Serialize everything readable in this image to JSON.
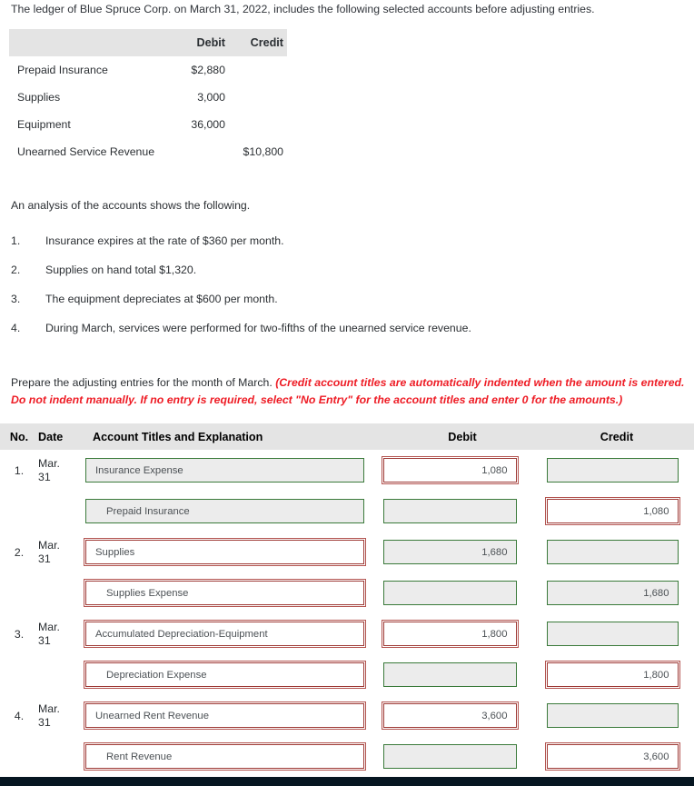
{
  "intro": "The ledger of Blue Spruce Corp. on March 31, 2022, includes the following selected accounts before adjusting entries.",
  "ledger": {
    "columns": {
      "debit": "Debit",
      "credit": "Credit"
    },
    "rows": [
      {
        "name": "Prepaid Insurance",
        "debit": "$2,880",
        "credit": ""
      },
      {
        "name": "Supplies",
        "debit": "3,000",
        "credit": ""
      },
      {
        "name": "Equipment",
        "debit": "36,000",
        "credit": ""
      },
      {
        "name": "Unearned Service Revenue",
        "debit": "",
        "credit": "$10,800"
      }
    ]
  },
  "analysis": {
    "lead": "An analysis of the accounts shows the following.",
    "items": [
      {
        "num": "1.",
        "text": "Insurance expires at the rate of $360 per month."
      },
      {
        "num": "2.",
        "text": "Supplies on hand total $1,320."
      },
      {
        "num": "3.",
        "text": "The equipment depreciates at $600 per month."
      },
      {
        "num": "4.",
        "text": "During March, services were performed for two-fifths of the unearned service revenue."
      }
    ]
  },
  "prompt": {
    "lead": "Prepare the adjusting entries for the month of March. ",
    "red": "(Credit account titles are automatically indented when the amount is entered. Do not indent manually. If no entry is required, select \"No Entry\" for the account titles and enter 0 for the amounts.)"
  },
  "journal": {
    "columns": {
      "no": "No.",
      "date": "Date",
      "account": "Account Titles and Explanation",
      "debit": "Debit",
      "credit": "Credit"
    },
    "rows": [
      {
        "no": "1.",
        "date_month": "Mar.",
        "date_day": "31",
        "account": "Insurance Expense",
        "account_state": "ok",
        "indent": false,
        "debit": "1,080",
        "debit_state": "bad",
        "credit": "",
        "credit_state": "ok"
      },
      {
        "no": "",
        "date_month": "",
        "date_day": "",
        "account": "Prepaid Insurance",
        "account_state": "ok",
        "indent": true,
        "debit": "",
        "debit_state": "ok",
        "credit": "1,080",
        "credit_state": "bad"
      },
      {
        "no": "2.",
        "date_month": "Mar.",
        "date_day": "31",
        "account": "Supplies",
        "account_state": "bad",
        "indent": false,
        "debit": "1,680",
        "debit_state": "ok",
        "credit": "",
        "credit_state": "ok"
      },
      {
        "no": "",
        "date_month": "",
        "date_day": "",
        "account": "Supplies Expense",
        "account_state": "bad",
        "indent": true,
        "debit": "",
        "debit_state": "ok",
        "credit": "1,680",
        "credit_state": "ok"
      },
      {
        "no": "3.",
        "date_month": "Mar.",
        "date_day": "31",
        "account": "Accumulated Depreciation-Equipment",
        "account_state": "bad",
        "indent": false,
        "debit": "1,800",
        "debit_state": "bad",
        "credit": "",
        "credit_state": "ok"
      },
      {
        "no": "",
        "date_month": "",
        "date_day": "",
        "account": "Depreciation Expense",
        "account_state": "bad",
        "indent": true,
        "debit": "",
        "debit_state": "ok",
        "credit": "1,800",
        "credit_state": "bad"
      },
      {
        "no": "4.",
        "date_month": "Mar.",
        "date_day": "31",
        "account": "Unearned Rent Revenue",
        "account_state": "bad",
        "indent": false,
        "debit": "3,600",
        "debit_state": "bad",
        "credit": "",
        "credit_state": "ok"
      },
      {
        "no": "",
        "date_month": "",
        "date_day": "",
        "account": "Rent Revenue",
        "account_state": "bad",
        "indent": true,
        "debit": "",
        "debit_state": "ok",
        "credit": "3,600",
        "credit_state": "bad"
      }
    ]
  },
  "colors": {
    "header_band": "#e4e4e4",
    "field_ok_border": "#3a7a3a",
    "field_bad_border": "#9e3a36",
    "field_fill": "#ececec",
    "red_text": "#ee1c25",
    "bottom_bar": "#061621"
  }
}
